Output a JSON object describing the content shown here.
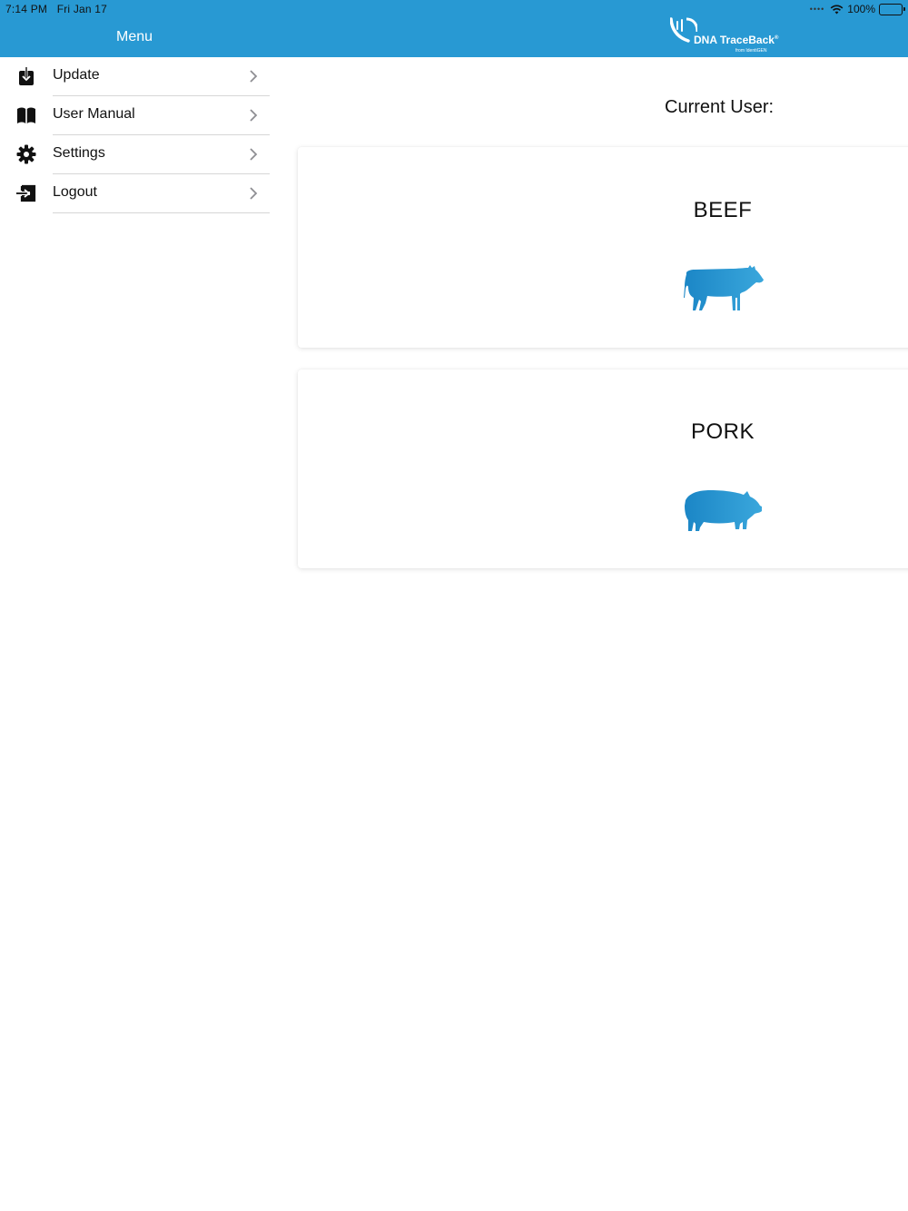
{
  "status_bar": {
    "time": "7:14 PM",
    "date": "Fri Jan 17",
    "battery": "100%"
  },
  "header": {
    "menu_title": "Menu",
    "logo_text": "DNA TraceBack",
    "logo_registered": "®",
    "logo_sub": "from IdentiGEN"
  },
  "sidebar": {
    "items": [
      {
        "label": "Update",
        "icon": "download-icon"
      },
      {
        "label": "User Manual",
        "icon": "book-icon"
      },
      {
        "label": "Settings",
        "icon": "gear-icon"
      },
      {
        "label": "Logout",
        "icon": "logout-icon"
      }
    ]
  },
  "main": {
    "current_user_label": "Current User:",
    "cards": [
      {
        "title": "BEEF",
        "icon": "cow-icon"
      },
      {
        "title": "PORK",
        "icon": "pig-icon"
      }
    ]
  },
  "colors": {
    "accent": "#2899d3",
    "animal_gradient_start": "#1b86c6",
    "animal_gradient_end": "#3aa7dc"
  }
}
